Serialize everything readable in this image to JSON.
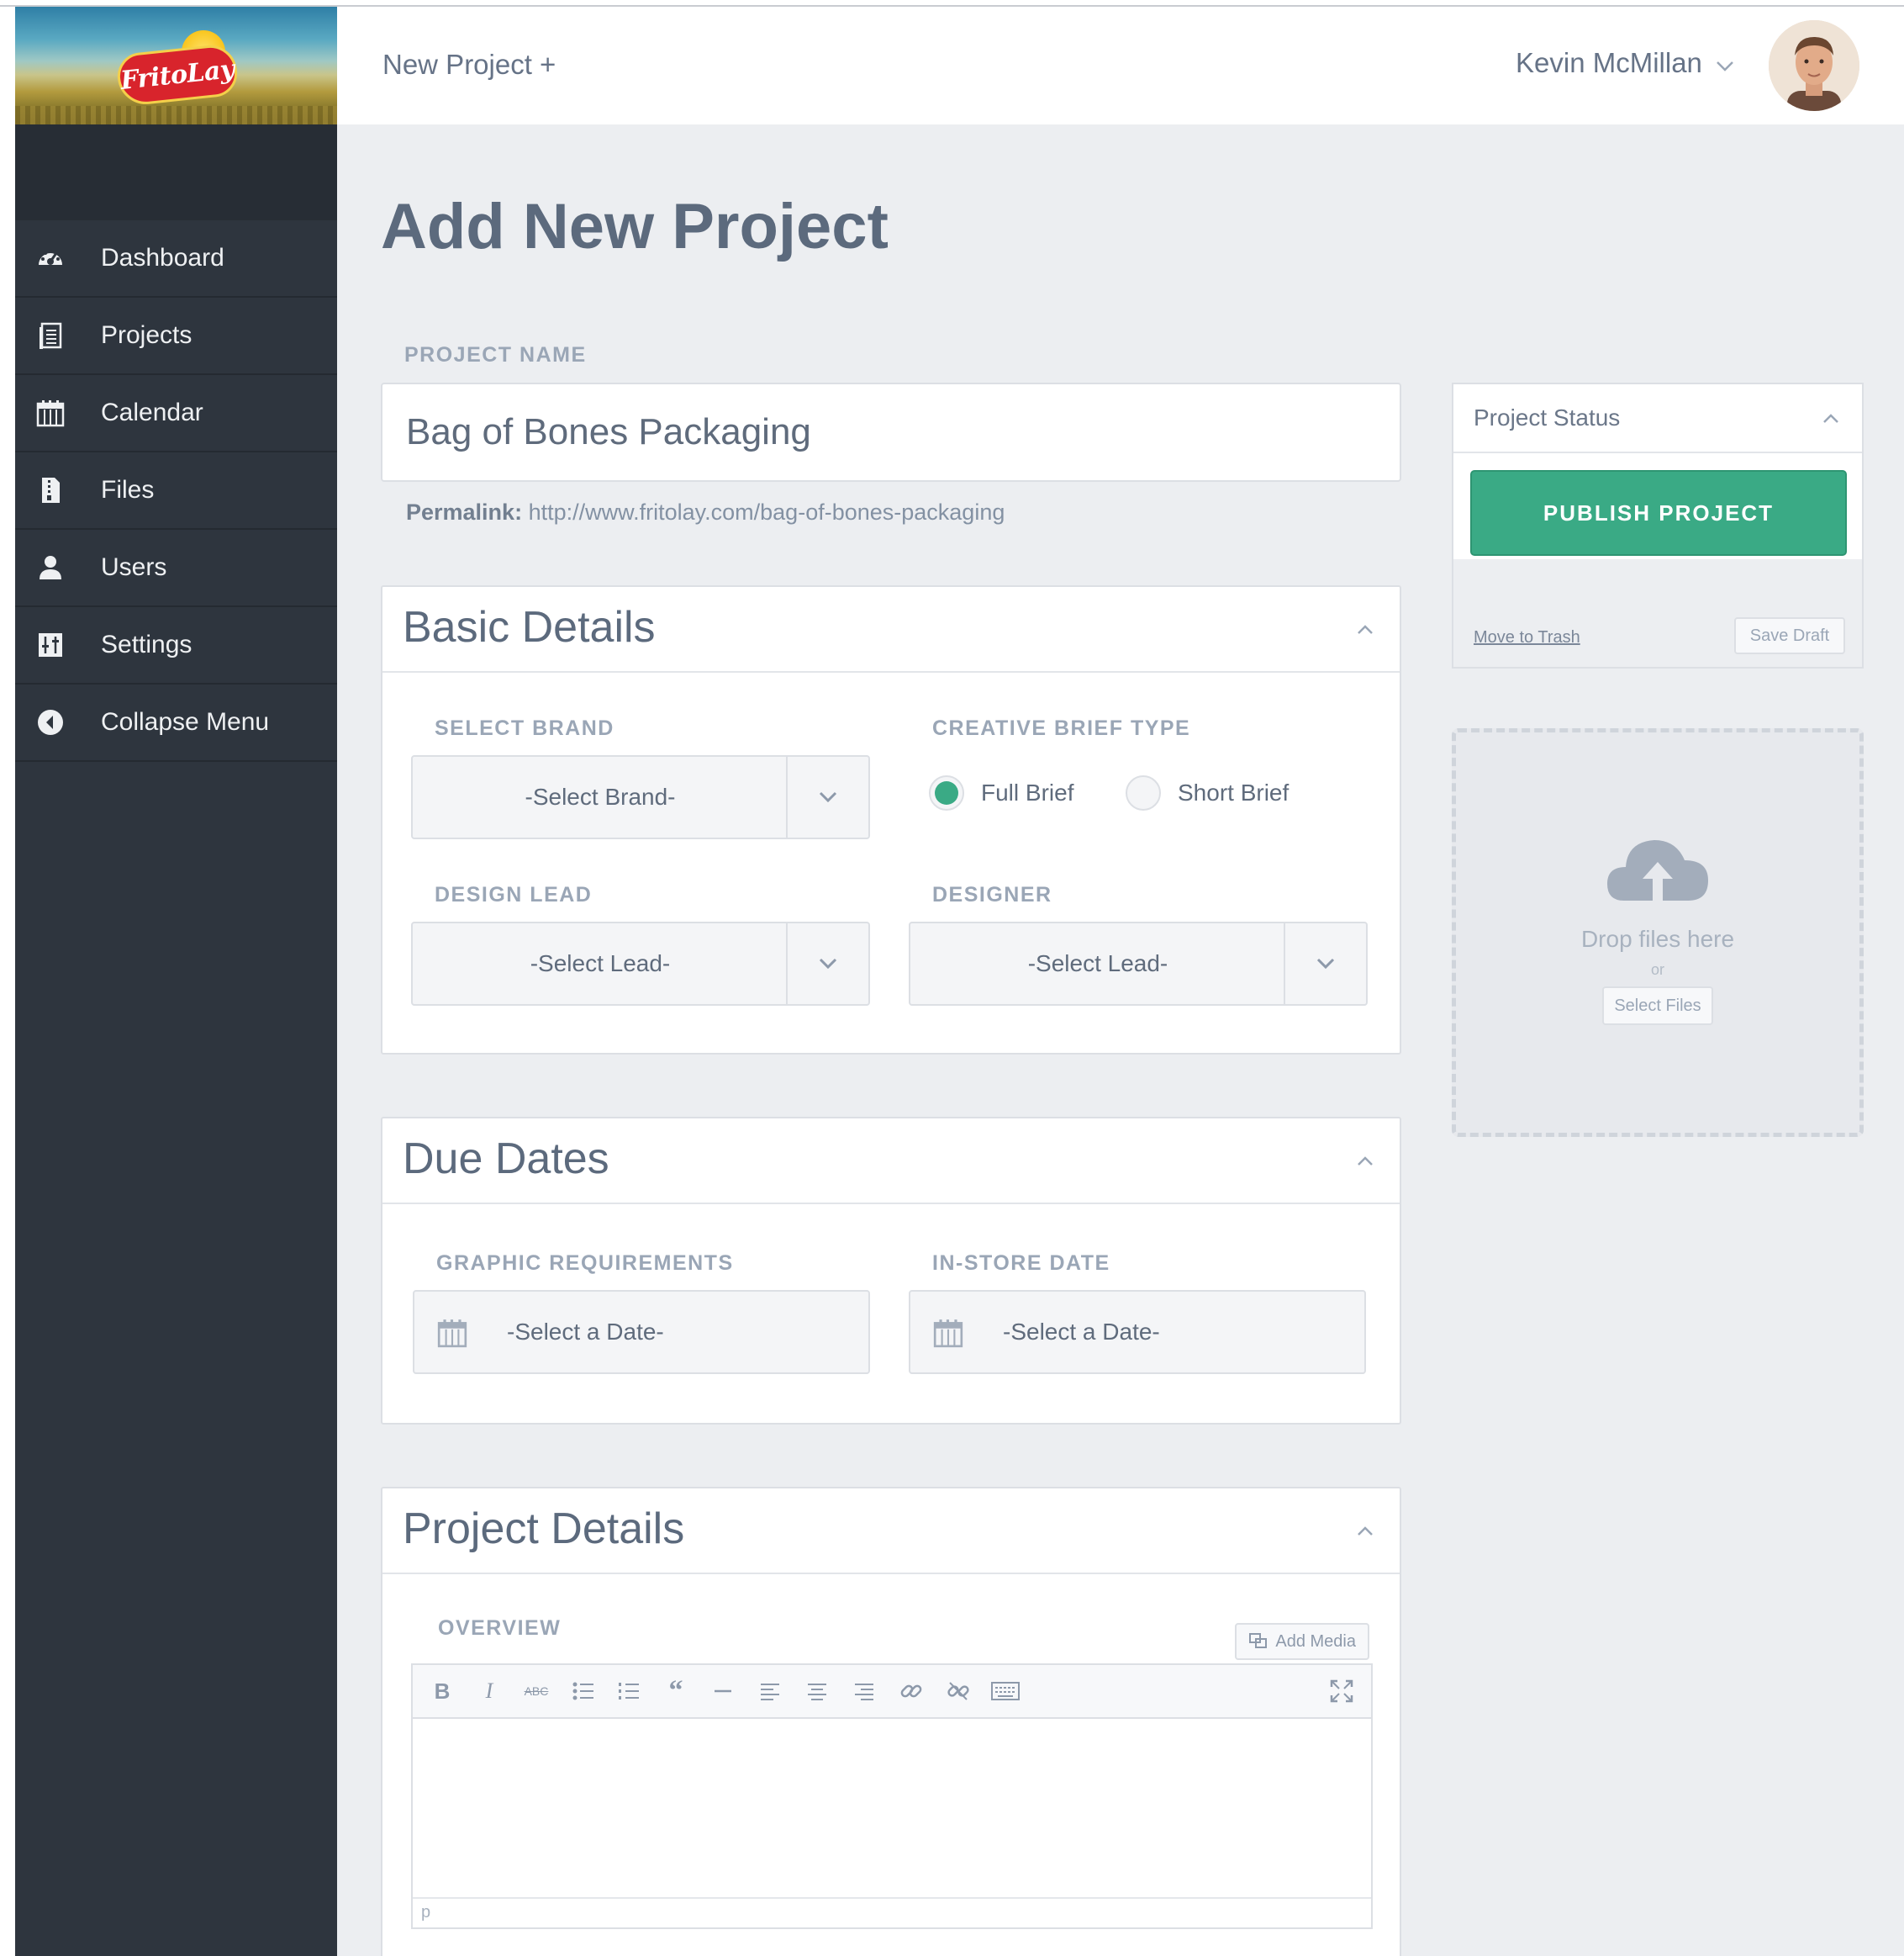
{
  "brand": {
    "logo_text": "FritoLay"
  },
  "sidebar": {
    "items": [
      {
        "label": "Dashboard",
        "icon": "dashboard-icon"
      },
      {
        "label": "Projects",
        "icon": "projects-icon"
      },
      {
        "label": "Calendar",
        "icon": "calendar-icon"
      },
      {
        "label": "Files",
        "icon": "file-icon"
      },
      {
        "label": "Users",
        "icon": "user-icon"
      },
      {
        "label": "Settings",
        "icon": "settings-icon"
      },
      {
        "label": "Collapse Menu",
        "icon": "collapse-icon"
      }
    ]
  },
  "topbar": {
    "new_project": "New Project +",
    "user_name": "Kevin McMillan"
  },
  "page": {
    "title": "Add New Project",
    "project_name_label": "PROJECT NAME",
    "project_name_value": "Bag of Bones Packaging",
    "permalink_label": "Permalink:",
    "permalink_url": "http://www.fritolay.com/bag-of-bones-packaging"
  },
  "basic_details": {
    "title": "Basic Details",
    "brand_label": "SELECT BRAND",
    "brand_value": "-Select Brand-",
    "brief_type_label": "CREATIVE BRIEF TYPE",
    "brief_options": [
      "Full Brief",
      "Short Brief"
    ],
    "brief_selected": "Full Brief",
    "design_lead_label": "DESIGN LEAD",
    "design_lead_value": "-Select Lead-",
    "designer_label": "DESIGNER",
    "designer_value": "-Select Lead-"
  },
  "due_dates": {
    "title": "Due Dates",
    "graphic_label": "GRAPHIC REQUIREMENTS",
    "graphic_placeholder": "-Select a Date-",
    "instore_label": "IN-STORE DATE",
    "instore_placeholder": "-Select a Date-"
  },
  "project_details": {
    "title": "Project Details",
    "overview_label": "OVERVIEW",
    "add_media": "Add Media",
    "editor_path": "p",
    "toolbar": {
      "bold": "B",
      "italic": "I",
      "strikethrough": "ABC"
    }
  },
  "status": {
    "title": "Project Status",
    "publish": "PUBLISH PROJECT",
    "move_to_trash": "Move to Trash",
    "save_draft": "Save Draft"
  },
  "upload": {
    "drop_text": "Drop files here",
    "or": "or",
    "select_files": "Select Files"
  },
  "colors": {
    "sidebar_bg": "#2e353e",
    "accent_green": "#3aaa85",
    "content_bg": "#eceef1"
  }
}
